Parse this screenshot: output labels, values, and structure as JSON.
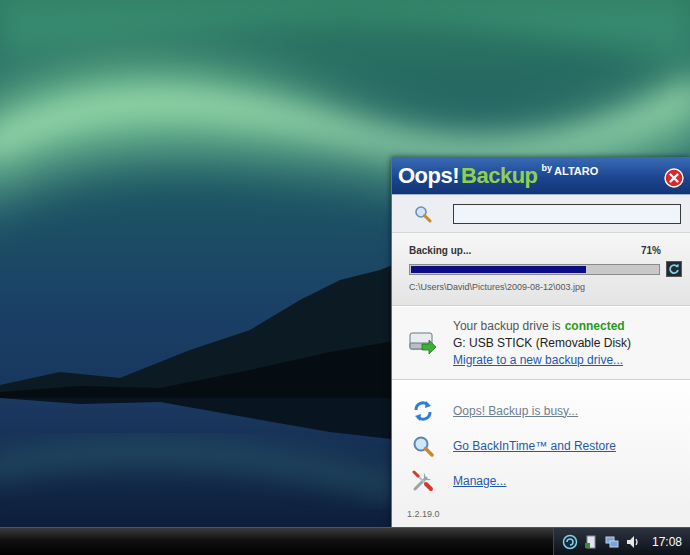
{
  "logo": {
    "oops": "Oops!",
    "backup": "Backup",
    "by": "by",
    "vendor": "ALTARO"
  },
  "search": {
    "value": ""
  },
  "progress": {
    "label": "Backing up...",
    "percent": "71%",
    "level": 0.71,
    "file": "C:\\Users\\David\\Pictures\\2009-08-12\\003.jpg"
  },
  "drive": {
    "status_prefix": "Your backup drive is",
    "status": "connected",
    "connected": true,
    "name": "G: USB STICK (Removable Disk)",
    "migrate": "Migrate to a new backup drive..."
  },
  "actions": [
    {
      "label": "Oops! Backup is busy...",
      "disabled": true,
      "kind": "busy"
    },
    {
      "label": "Go BackInTime™ and Restore",
      "disabled": false,
      "kind": "restore"
    },
    {
      "label": "Manage...",
      "disabled": false,
      "kind": "manage"
    }
  ],
  "version": "1.2.19.0",
  "taskbar": {
    "time": "17:08"
  }
}
